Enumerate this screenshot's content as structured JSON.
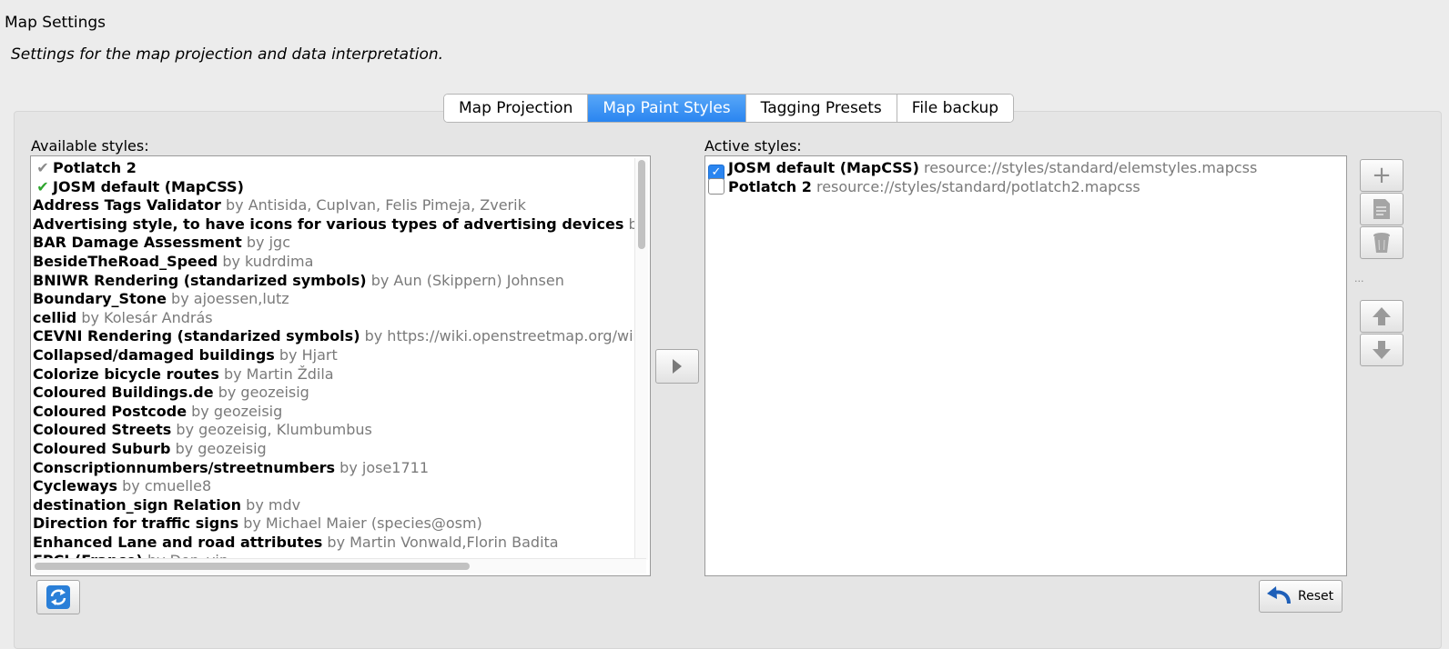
{
  "window": {
    "title": "Map Settings",
    "subtitle": "Settings for the map projection and data interpretation."
  },
  "tabs": [
    {
      "label": "Map Projection",
      "active": false
    },
    {
      "label": "Map Paint Styles",
      "active": true
    },
    {
      "label": "Tagging Presets",
      "active": false
    },
    {
      "label": "File backup",
      "active": false
    }
  ],
  "available": {
    "label": "Available styles:",
    "items": [
      {
        "name": "Potlatch 2",
        "by": "",
        "check": "gray"
      },
      {
        "name": "JOSM default (MapCSS)",
        "by": "",
        "check": "green"
      },
      {
        "name": "Address Tags Validator",
        "by": "by Antisida, CupIvan, Felis Pimeja, Zverik"
      },
      {
        "name": "Advertising style, to have icons for various types of advertising devices",
        "by": "by Ba"
      },
      {
        "name": "BAR Damage Assessment",
        "by": "by jgc"
      },
      {
        "name": "BesideTheRoad_Speed",
        "by": "by kudrdima"
      },
      {
        "name": "BNIWR Rendering (standarized symbols)",
        "by": "by Aun (Skippern) Johnsen"
      },
      {
        "name": "Boundary_Stone",
        "by": "by ajoessen,lutz"
      },
      {
        "name": "cellid",
        "by": "by Kolesár András"
      },
      {
        "name": "CEVNI Rendering (standarized symbols)",
        "by": "by https://wiki.openstreetmap.org/wiki/"
      },
      {
        "name": "Collapsed/damaged buildings",
        "by": "by Hjart"
      },
      {
        "name": "Colorize bicycle routes",
        "by": "by Martin Ždila"
      },
      {
        "name": "Coloured Buildings.de",
        "by": "by geozeisig"
      },
      {
        "name": "Coloured Postcode",
        "by": "by geozeisig"
      },
      {
        "name": "Coloured Streets",
        "by": "by geozeisig, Klumbumbus"
      },
      {
        "name": "Coloured Suburb",
        "by": "by geozeisig"
      },
      {
        "name": "Conscriptionnumbers/streetnumbers",
        "by": "by jose1711"
      },
      {
        "name": "Cycleways",
        "by": "by cmuelle8"
      },
      {
        "name": "destination_sign Relation",
        "by": "by mdv"
      },
      {
        "name": "Direction for traffic signs",
        "by": "by Michael Maier (species@osm)"
      },
      {
        "name": "Enhanced Lane and road attributes",
        "by": "by Martin Vonwald,Florin Badita"
      },
      {
        "name": "EPCI (France)",
        "by": "by Don_vip"
      }
    ]
  },
  "active": {
    "label": "Active styles:",
    "items": [
      {
        "name": "JOSM default (MapCSS)",
        "url": "resource://styles/standard/elemstyles.mapcss",
        "checked": true,
        "check_mark": "✓"
      },
      {
        "name": "Potlatch 2",
        "url": "resource://styles/standard/potlatch2.mapcss",
        "checked": false,
        "check_mark": ""
      }
    ]
  },
  "buttons": {
    "reset_label": "Reset",
    "dots": "..."
  },
  "icons": {
    "refresh": "refresh-icon",
    "move_right": "arrow-right-icon",
    "add": "plus-icon",
    "edit": "edit-icon",
    "delete": "trash-icon",
    "up": "arrow-up-icon",
    "down": "arrow-down-icon",
    "reset": "undo-arrow-icon"
  },
  "colors": {
    "tab_active": "#2a85f0",
    "check_green": "#2ea52e",
    "checkbox_on": "#2a85f0"
  }
}
